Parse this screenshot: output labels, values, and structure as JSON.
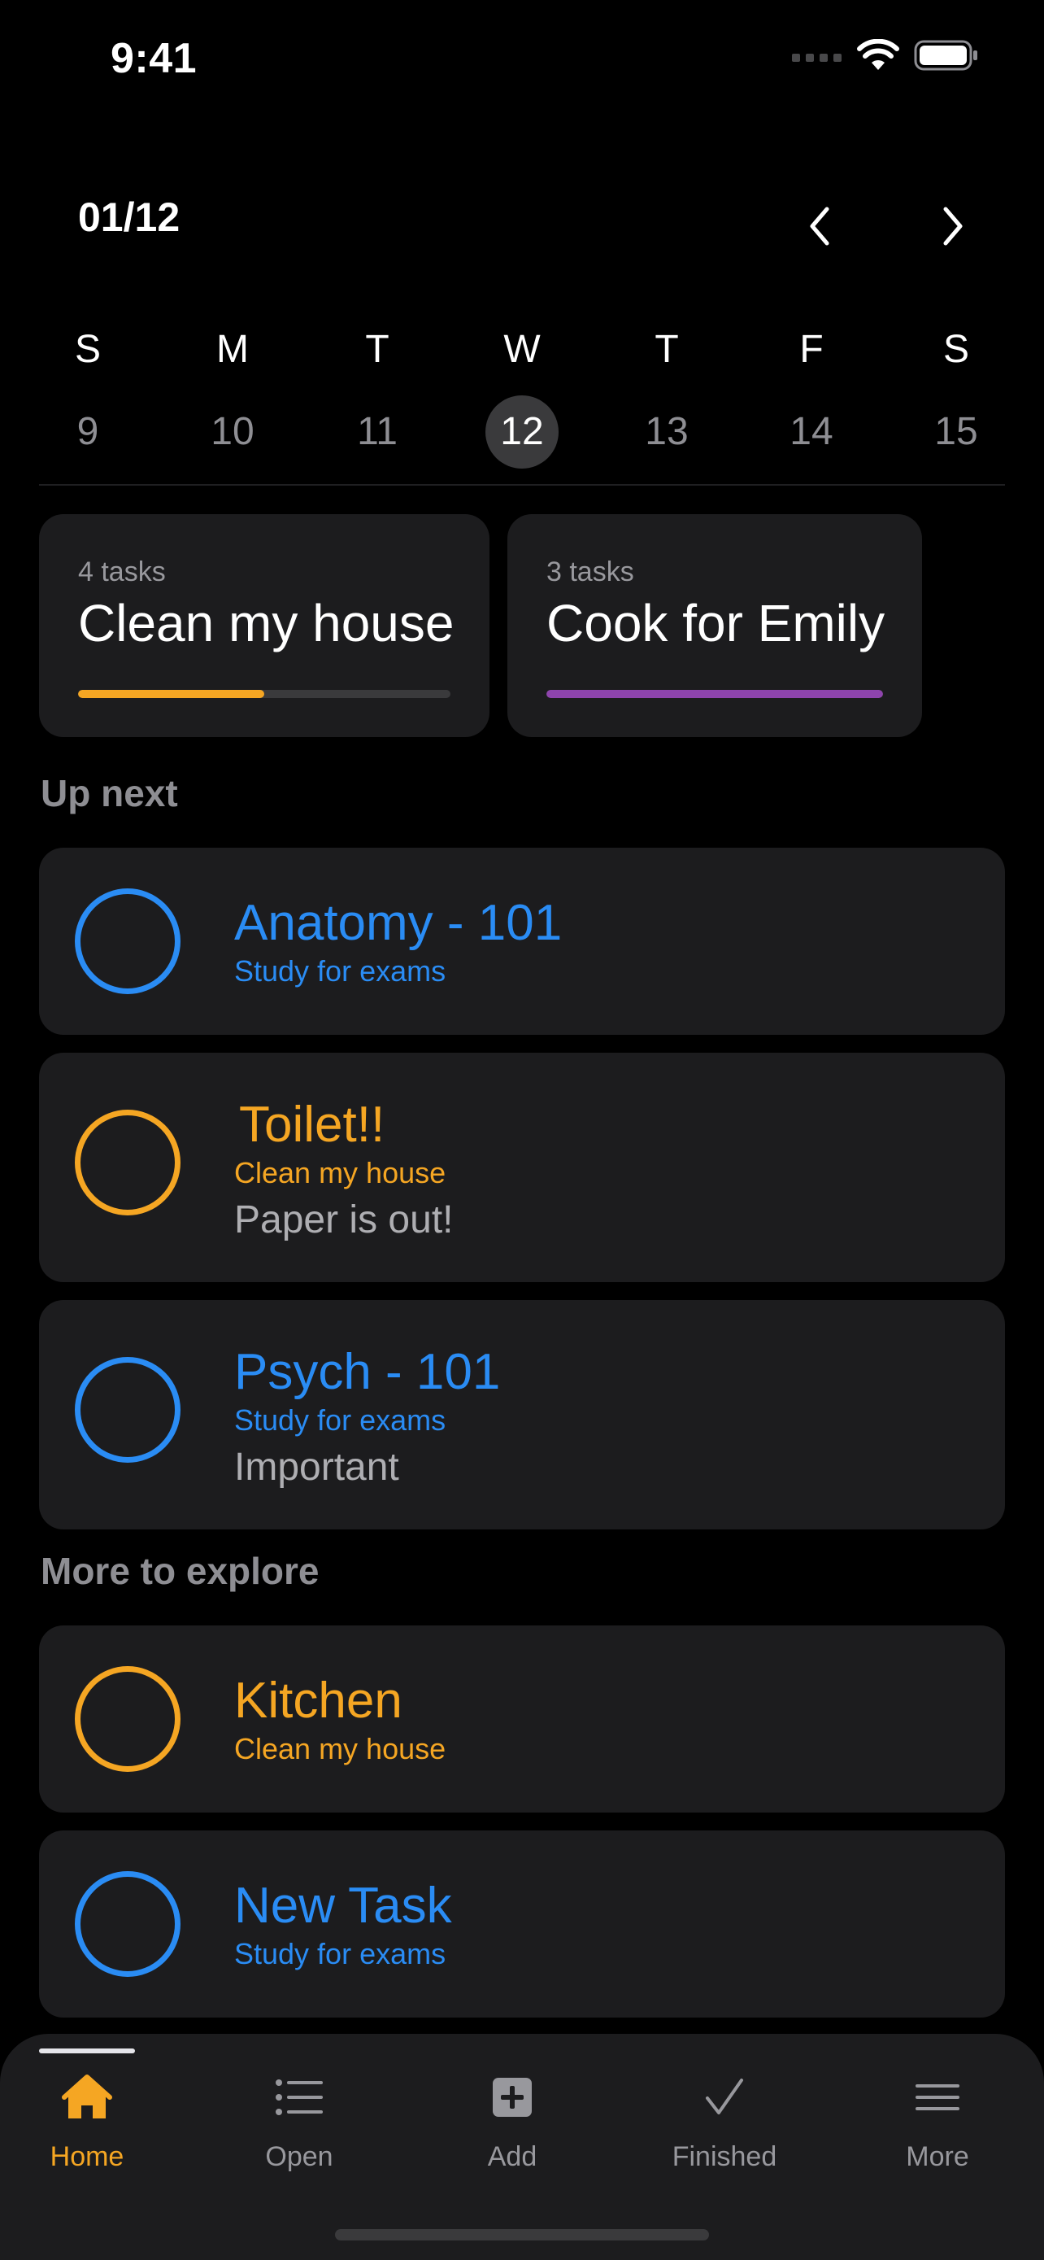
{
  "status_bar": {
    "time": "9:41"
  },
  "header": {
    "month_label": "01/12"
  },
  "week": {
    "days": [
      {
        "letter": "S",
        "num": "9"
      },
      {
        "letter": "M",
        "num": "10"
      },
      {
        "letter": "T",
        "num": "11"
      },
      {
        "letter": "W",
        "num": "12",
        "selected": true
      },
      {
        "letter": "T",
        "num": "13"
      },
      {
        "letter": "F",
        "num": "14"
      },
      {
        "letter": "S",
        "num": "15"
      }
    ]
  },
  "projects": [
    {
      "count": "4 tasks",
      "title": "Clean my house",
      "progress": 0.5,
      "color": "#f5a623"
    },
    {
      "count": "3 tasks",
      "title": "Cook for Emily",
      "progress": 1.0,
      "color": "#8e44ad"
    }
  ],
  "up_next": {
    "title": "Up next",
    "tasks": [
      {
        "title": "Anatomy - 101",
        "subtitle": "Study for exams",
        "note": "",
        "color": "#2a8cf4"
      },
      {
        "title": "Toilet!!",
        "subtitle": "Clean my house",
        "note": "Paper is out!",
        "color": "#f5a623"
      },
      {
        "title": "Psych - 101",
        "subtitle": "Study for exams",
        "note": "Important",
        "color": "#2a8cf4"
      }
    ]
  },
  "more_to_explore": {
    "title": "More to explore",
    "tasks": [
      {
        "title": "Kitchen",
        "subtitle": "Clean my house",
        "note": "",
        "color": "#f5a623"
      },
      {
        "title": "New Task",
        "subtitle": "Study for exams",
        "note": "",
        "color": "#2a8cf4"
      }
    ]
  },
  "tabbar": {
    "tabs": [
      {
        "label": "Home",
        "icon": "house-icon",
        "active": true
      },
      {
        "label": "Open",
        "icon": "list-icon"
      },
      {
        "label": "Add",
        "icon": "plus-square-icon"
      },
      {
        "label": "Finished",
        "icon": "checkmark-icon"
      },
      {
        "label": "More",
        "icon": "menu-icon"
      }
    ],
    "active_color": "#f5a623",
    "inactive_color": "#98989d"
  }
}
